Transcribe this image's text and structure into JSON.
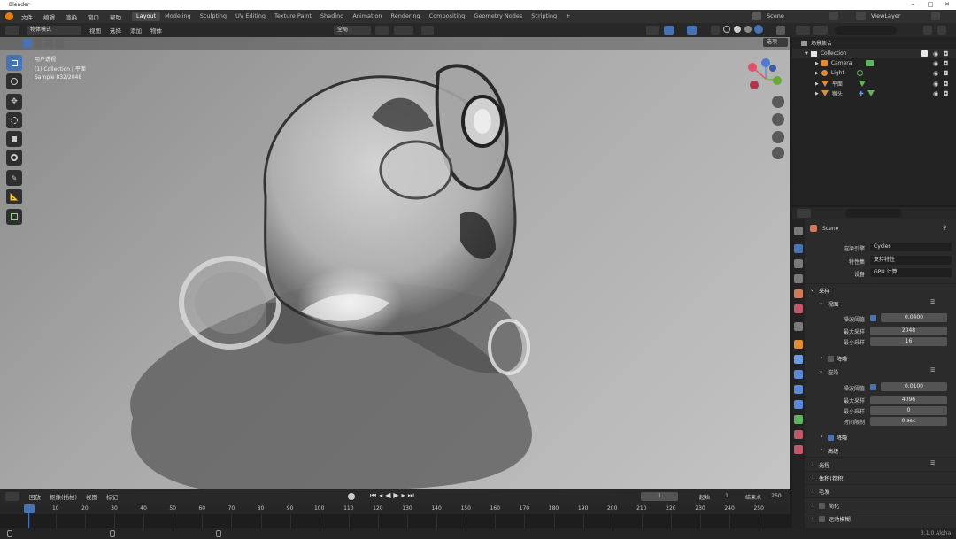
{
  "titlebar": {
    "app": "Blender",
    "minimize": "–",
    "maximize": "□",
    "close": "✕"
  },
  "menu": [
    "文件",
    "编辑",
    "渲染",
    "窗口",
    "帮助"
  ],
  "workspaces": [
    "Layout",
    "Modeling",
    "Sculpting",
    "UV Editing",
    "Texture Paint",
    "Shading",
    "Animation",
    "Rendering",
    "Compositing",
    "Geometry Nodes",
    "Scripting",
    "+"
  ],
  "active_workspace": "Layout",
  "scene": {
    "name": "Scene",
    "viewlayer": "ViewLayer"
  },
  "viewport_header": {
    "mode": "物体模式",
    "menus": [
      "视图",
      "选择",
      "添加",
      "物体"
    ],
    "global": "全局",
    "options": "选项"
  },
  "viewport": {
    "overlay_lines": [
      "用户透视",
      "(1) Collection | 平面",
      "Sample 832/2048"
    ]
  },
  "outliner": {
    "root": "场景集合",
    "collection": "Collection",
    "items": [
      {
        "label": "Camera",
        "color": "#e08c3a"
      },
      {
        "label": "Light",
        "color": "#e08c3a"
      },
      {
        "label": "平面",
        "color": "#e08c3a"
      },
      {
        "label": "猴头",
        "color": "#e08c3a"
      }
    ]
  },
  "properties": {
    "scene_name": "Scene",
    "render_engine_label": "渲染引擎",
    "render_engine": "Cycles",
    "feature_set_label": "特性集",
    "feature_set": "支持特性",
    "device_label": "设备",
    "device": "GPU 计算",
    "sampling": "采样",
    "viewport": "视图",
    "noise_threshold_label": "噪波阈值",
    "vp_noise_threshold": "0.0400",
    "max_samples_label": "最大采样",
    "vp_max_samples": "2048",
    "min_samples_label": "最小采样",
    "vp_min_samples": "16",
    "denoise": "降噪",
    "render": "渲染",
    "r_noise_threshold": "0.0100",
    "r_max_samples": "4096",
    "r_min_samples": "0",
    "time_limit_label": "时间限制",
    "r_time_limit": "0 sec",
    "denoise2": "降噪",
    "advanced": "高级",
    "light_paths": "光程",
    "volumes": "体积(卷积)",
    "hair": "毛发",
    "simplify": "简化",
    "motion_blur": "运动模糊"
  },
  "timeline": {
    "menus": [
      "回放",
      "抠像(插帧)",
      "视图",
      "标记"
    ],
    "current_frame": "1",
    "start_label": "起始",
    "start": "1",
    "end_label": "结束点",
    "end": "250",
    "ticks": [
      "1",
      "10",
      "20",
      "30",
      "40",
      "50",
      "60",
      "70",
      "80",
      "90",
      "100",
      "110",
      "120",
      "130",
      "140",
      "150",
      "160",
      "170",
      "180",
      "190",
      "200",
      "210",
      "220",
      "230",
      "240",
      "250"
    ]
  },
  "status": {
    "version": "3.1.0 Alpha"
  },
  "colors": {
    "accent": "#4772b3",
    "object_orange": "#e08c3a",
    "data_green": "#5fb35f"
  }
}
